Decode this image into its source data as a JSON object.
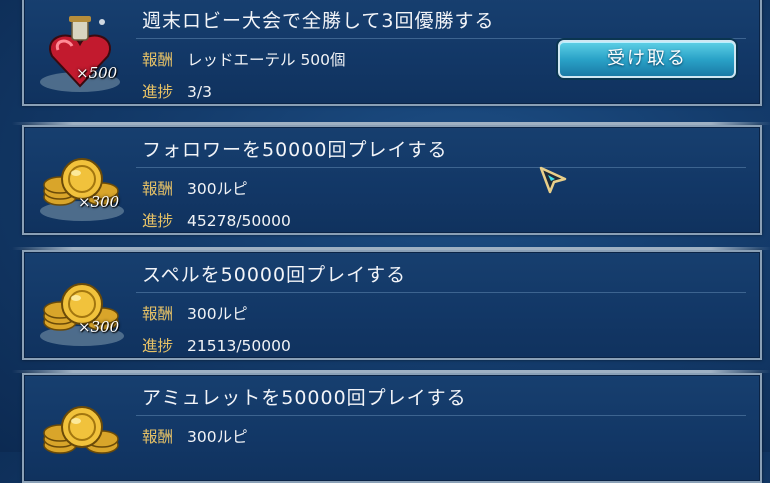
{
  "missions": [
    {
      "title": "週末ロビー大会で全勝して3回優勝する",
      "reward_label": "報酬",
      "reward_value": "レッドエーテル 500個",
      "progress_label": "進捗",
      "progress_value": "3/3",
      "icon": "red-ether-icon",
      "qty": "×500",
      "claim_label": "受け取る"
    },
    {
      "title": "フォロワーを50000回プレイする",
      "reward_label": "報酬",
      "reward_value": "300ルピ",
      "progress_label": "進捗",
      "progress_value": "45278/50000",
      "icon": "rupy-coins-icon",
      "qty": "×300"
    },
    {
      "title": "スペルを50000回プレイする",
      "reward_label": "報酬",
      "reward_value": "300ルピ",
      "progress_label": "進捗",
      "progress_value": "21513/50000",
      "icon": "rupy-coins-icon",
      "qty": "×300"
    },
    {
      "title": "アミュレットを50000回プレイする",
      "reward_label": "報酬",
      "reward_value": "300ルピ",
      "icon": "rupy-coins-icon"
    }
  ],
  "colors": {
    "background": "#143c6c",
    "label_gold": "#e7c266",
    "button_cyan": "#2aa3c8"
  }
}
